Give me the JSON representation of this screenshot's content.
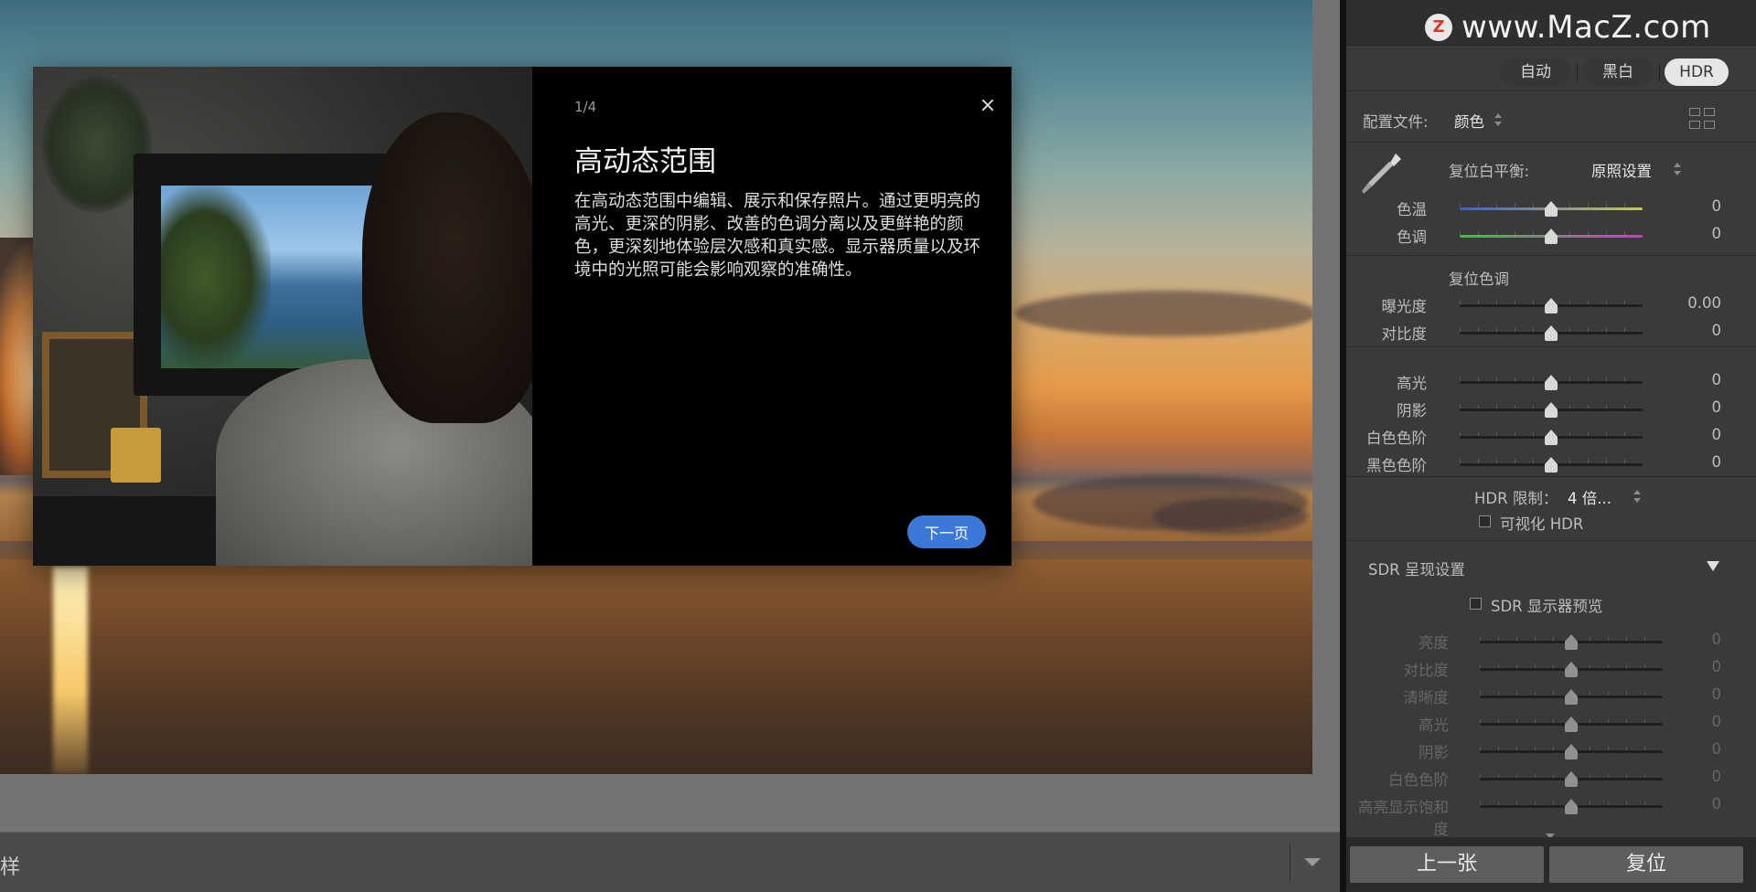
{
  "watermark": {
    "text": "www.MacZ.com"
  },
  "modes": [
    {
      "label": "自动",
      "active": false
    },
    {
      "label": "黑白",
      "active": false
    },
    {
      "label": "HDR",
      "active": true
    }
  ],
  "profile": {
    "label": "配置文件:",
    "value": "颜色"
  },
  "white_balance": {
    "label": "复位白平衡:",
    "value": "原照设置"
  },
  "wb_sliders": [
    {
      "label": "色温",
      "value": "0",
      "position": 0.5,
      "track": "linear-gradient(90deg,#3a5fd0,#c8c850)"
    },
    {
      "label": "色调",
      "value": "0",
      "position": 0.5,
      "track": "linear-gradient(90deg,#45c045,#c040c0)"
    }
  ],
  "tone": {
    "reset_label": "复位色调"
  },
  "tone_sliders": [
    {
      "label": "曝光度",
      "value": "0.00",
      "position": 0.5
    },
    {
      "label": "对比度",
      "value": "0",
      "position": 0.5
    }
  ],
  "hl_sliders": [
    {
      "label": "高光",
      "value": "0",
      "position": 0.5
    },
    {
      "label": "阴影",
      "value": "0",
      "position": 0.5
    },
    {
      "label": "白色色阶",
      "value": "0",
      "position": 0.5
    },
    {
      "label": "黑色色阶",
      "value": "0",
      "position": 0.5
    }
  ],
  "hdr_limit": {
    "label": "HDR 限制：",
    "value": "4 倍...",
    "visualize_label": "可视化 HDR",
    "visualize_checked": false
  },
  "sdr": {
    "header": "SDR 呈现设置",
    "preview_label": "SDR 显示器预览",
    "preview_checked": false,
    "sliders": [
      {
        "label": "亮度",
        "value": "0",
        "position": 0.5
      },
      {
        "label": "对比度",
        "value": "0",
        "position": 0.5
      },
      {
        "label": "清晰度",
        "value": "0",
        "position": 0.5
      },
      {
        "label": "高光",
        "value": "0",
        "position": 0.5
      },
      {
        "label": "阴影",
        "value": "0",
        "position": 0.5
      },
      {
        "label": "白色色阶",
        "value": "0",
        "position": 0.5
      },
      {
        "label": "高亮显示饱和度",
        "value": "0",
        "position": 0.5
      }
    ]
  },
  "bottom_buttons": {
    "prev": "上一张",
    "reset": "复位"
  },
  "toolbar": {
    "label": "样"
  },
  "dialog": {
    "step": "1/4",
    "title": "高动态范围",
    "body": "在高动态范围中编辑、展示和保存照片。通过更明亮的高光、更深的阴影、改善的色调分离以及更鲜艳的颜色，更深刻地体验层次感和真实感。显示器质量以及环境中的光照可能会影响观察的准确性。",
    "next": "下一页"
  }
}
